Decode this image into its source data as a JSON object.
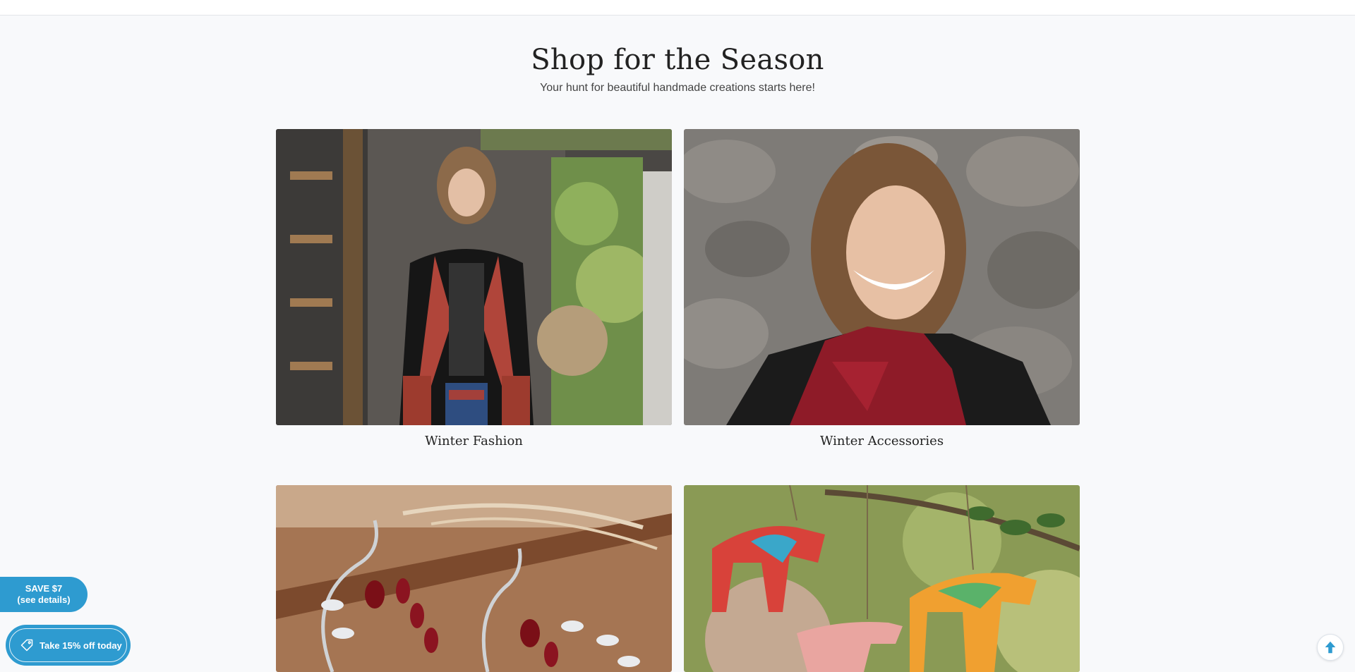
{
  "section": {
    "title": "Shop for the Season",
    "subtitle": "Your hunt for beautiful handmade creations starts here!"
  },
  "cards": [
    {
      "label": "Winter Fashion",
      "image": "woman-black-embroidered-jacket-photo"
    },
    {
      "label": "Winter Accessories",
      "image": "woman-red-scarf-photo"
    },
    {
      "label": "",
      "image": "garnet-silver-earrings-photo"
    },
    {
      "label": "",
      "image": "painted-horse-ornaments-photo"
    }
  ],
  "promo": {
    "save_line1": "SAVE $7",
    "save_line2": "(see details)",
    "discount_label": "Take 15% off today",
    "icon": "tag-icon"
  },
  "scroll_top": {
    "icon": "arrow-up-icon"
  },
  "colors": {
    "accent": "#2e9bd0",
    "background": "#f8f9fb",
    "text": "#222222"
  }
}
